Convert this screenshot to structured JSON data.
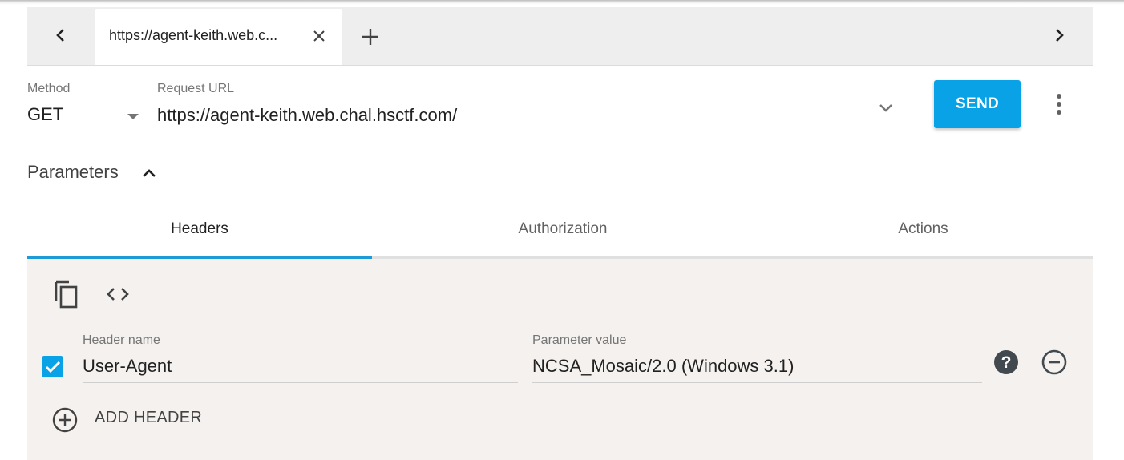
{
  "request_tab": {
    "label": "https://agent-keith.web.c..."
  },
  "request": {
    "method_label": "Method",
    "method_value": "GET",
    "url_label": "Request URL",
    "url_value": "https://agent-keith.web.chal.hsctf.com/",
    "send_label": "SEND"
  },
  "parameters": {
    "title": "Parameters"
  },
  "tabs": [
    {
      "label": "Headers",
      "active": true
    },
    {
      "label": "Authorization",
      "active": false
    },
    {
      "label": "Actions",
      "active": false
    }
  ],
  "headers": {
    "name_label": "Header name",
    "value_label": "Parameter value",
    "rows": [
      {
        "enabled": true,
        "name": "User-Agent",
        "value": "NCSA_Mosaic/2.0 (Windows 3.1)"
      }
    ],
    "add_label": "ADD HEADER"
  },
  "icons": [
    "chevron-left-icon",
    "close-icon",
    "plus-icon",
    "chevron-right-icon",
    "dropdown-arrow-icon",
    "chevron-down-icon",
    "more-vert-icon",
    "chevron-up-icon",
    "copy-icon",
    "code-icon",
    "checkmark-icon",
    "help-icon",
    "remove-icon",
    "add-circle-icon"
  ],
  "colors": {
    "accent": "#0aa2e6",
    "tab_indicator": "#1e9ad6",
    "panel_bg": "#f4f1ee",
    "tabbar_bg": "#eeeeee"
  }
}
